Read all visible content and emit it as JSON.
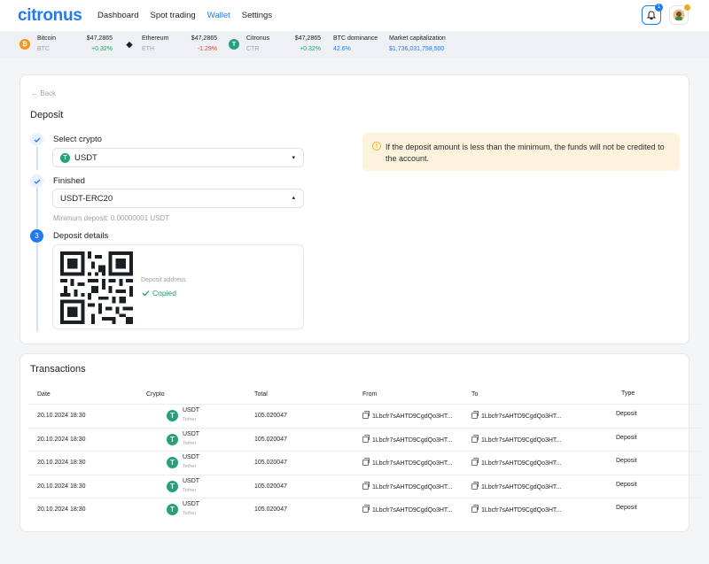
{
  "app": {
    "logo": "citronus"
  },
  "nav": {
    "items": [
      {
        "label": "Dashboard",
        "active": false
      },
      {
        "label": "Spot trading",
        "active": false
      },
      {
        "label": "Wallet",
        "active": true
      },
      {
        "label": "Settings",
        "active": false
      }
    ],
    "notifications_count": "1"
  },
  "ticker": {
    "bitcoin": {
      "name": "Bitcoin",
      "symbol": "BTC",
      "price": "$47,2865",
      "change": "+0.32%"
    },
    "ethereum": {
      "name": "Ethereum",
      "symbol": "ETH",
      "price": "$47,2865",
      "change": "-1.29%"
    },
    "citronus": {
      "name": "Citronus",
      "symbol": "CTR",
      "price": "$47,2865",
      "change": "+0.32%"
    },
    "btc_dominance": {
      "label": "BTC dominance",
      "value": "42.6%"
    },
    "market_cap": {
      "label": "Market capitalization",
      "value": "$1,736,031,758,500"
    }
  },
  "deposit": {
    "back_label": "Back",
    "title": "Deposit",
    "step1": {
      "label": "Select crypto",
      "value": "USDT"
    },
    "step2": {
      "label": "Finished",
      "value": "USDT-ERC20",
      "hint": "Minimum deposit: 0.00000001 USDT"
    },
    "step3": {
      "number": "3",
      "label": "Deposit details",
      "address_label": "Deposit address",
      "copied_label": "Copied"
    },
    "warning": "If the deposit amount is less than the minimum, the funds will not be credited to the account."
  },
  "transactions": {
    "title": "Transactions",
    "columns": {
      "date": "Date",
      "crypto": "Crypto",
      "total": "Total",
      "from": "From",
      "to": "To",
      "type": "Type"
    },
    "rows": [
      {
        "date": "20.10.2024 18:30",
        "coin": "USDT",
        "coin_name": "Tether",
        "total": "105.020047",
        "from": "1Lbcfr7sAHTD9CgdQo3HT...",
        "to": "1Lbcfr7sAHTD9CgdQo3HT...",
        "type": "Deposit"
      },
      {
        "date": "20.10.2024 18:30",
        "coin": "USDT",
        "coin_name": "Tether",
        "total": "105.020047",
        "from": "1Lbcfr7sAHTD9CgdQo3HT...",
        "to": "1Lbcfr7sAHTD9CgdQo3HT...",
        "type": "Deposit"
      },
      {
        "date": "20.10.2024 18:30",
        "coin": "USDT",
        "coin_name": "Tether",
        "total": "105.020047",
        "from": "1Lbcfr7sAHTD9CgdQo3HT...",
        "to": "1Lbcfr7sAHTD9CgdQo3HT...",
        "type": "Deposit"
      },
      {
        "date": "20.10.2024 18:30",
        "coin": "USDT",
        "coin_name": "Tether",
        "total": "105.020047",
        "from": "1Lbcfr7sAHTD9CgdQo3HT...",
        "to": "1Lbcfr7sAHTD9CgdQo3HT...",
        "type": "Deposit"
      },
      {
        "date": "20.10.2024 18:30",
        "coin": "USDT",
        "coin_name": "Tether",
        "total": "105.020047",
        "from": "1Lbcfr7sAHTD9CgdQo3HT...",
        "to": "1Lbcfr7sAHTD9CgdQo3HT...",
        "type": "Deposit"
      }
    ]
  },
  "colors": {
    "accent": "#1f7bf0",
    "up": "#19a463",
    "down": "#e0423b",
    "warning_bg": "#fdf3dc",
    "tether": "#26a17b"
  }
}
